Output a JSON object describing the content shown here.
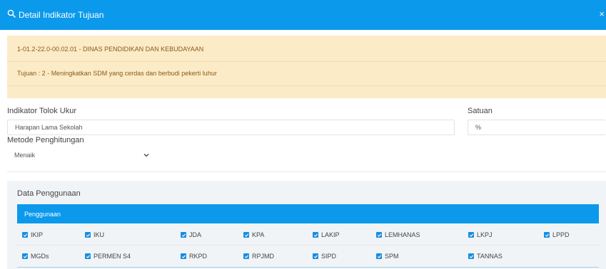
{
  "modal": {
    "title": "Detail Indikator Tujuan",
    "close_label": "×"
  },
  "info": {
    "unit_line": "1-01.2-22.0-00.02.01 - DINAS PENDIDIKAN DAN KEBUDAYAAN",
    "tujuan_line": "Tujuan : 2 - Meningkatkan SDM yang cerdas dan berbudi pekerti luhur"
  },
  "form": {
    "indikator_label": "Indikator Tolok Ukur",
    "indikator_value": "Harapan Lama Sekolah",
    "satuan_label": "Satuan",
    "satuan_value": "%",
    "metode_label": "Metode Penghitungan",
    "metode_value": "Menaik"
  },
  "usage": {
    "section_title": "Data Penggunaan",
    "header_label": "Penggunaan",
    "items": [
      {
        "label": "IKIP",
        "checked": true
      },
      {
        "label": "IKU",
        "checked": true
      },
      {
        "label": "JDA",
        "checked": true
      },
      {
        "label": "KPA",
        "checked": true
      },
      {
        "label": "LAKIP",
        "checked": true
      },
      {
        "label": "LEMHANAS",
        "checked": true
      },
      {
        "label": "LKPJ",
        "checked": true
      },
      {
        "label": "LPPD",
        "checked": true
      },
      {
        "label": "MGDs",
        "checked": true
      },
      {
        "label": "PERMEN S4",
        "checked": true
      },
      {
        "label": "RKPD",
        "checked": true
      },
      {
        "label": "RPJMD",
        "checked": true
      },
      {
        "label": "SIPD",
        "checked": true
      },
      {
        "label": "SPM",
        "checked": true
      },
      {
        "label": "TANNAS",
        "checked": true
      }
    ]
  }
}
